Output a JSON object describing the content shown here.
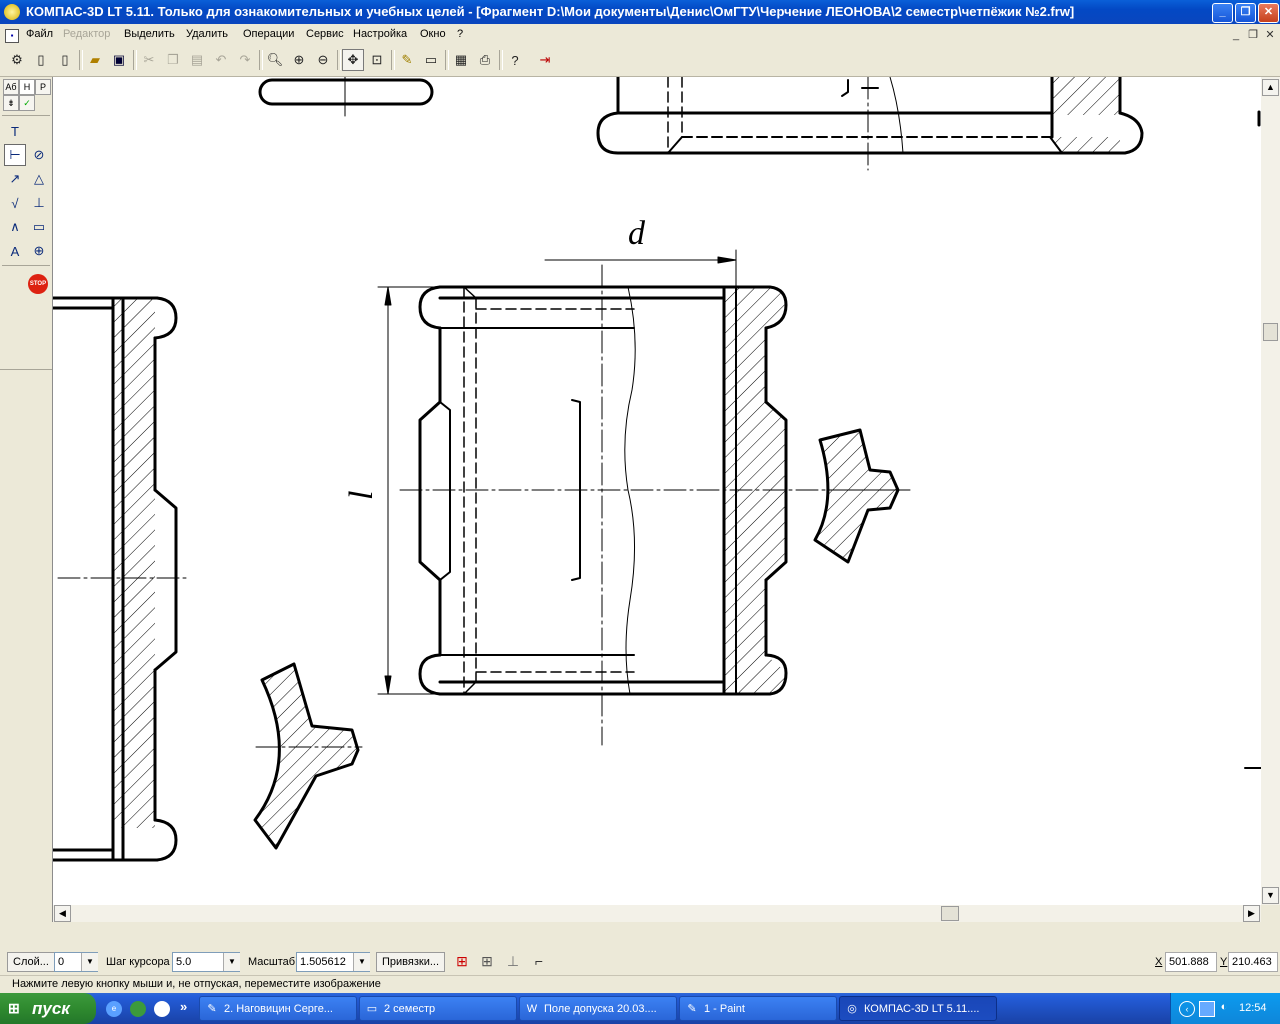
{
  "window": {
    "title": "КОМПАС-3D LT 5.11. Только для ознакомительных и учебных целей - [Фрагмент D:\\Мои документы\\Денис\\ОмГТУ\\Черчение ЛЕОНОВА\\2 семестр\\четпёжик №2.frw]",
    "min": "_",
    "max": "❐",
    "close": "✕"
  },
  "menu": {
    "items": [
      "Файл",
      "Редактор",
      "Выделить",
      "Удалить",
      "Операции",
      "Сервис",
      "Настройка",
      "Окно",
      "?"
    ],
    "doc_controls": [
      "_",
      "❐",
      "✕"
    ]
  },
  "toolbar": {
    "icons": [
      "gear-icon",
      "new-icon",
      "new-fragment-icon",
      "open-folder-icon",
      "save-icon",
      "cut-icon",
      "copy-icon",
      "paste-icon",
      "undo-icon",
      "redo-icon",
      "zoom-icon",
      "zoom-in-icon",
      "zoom-out-icon",
      "pan-icon",
      "zoom-fit-icon",
      "layers-icon",
      "refresh-icon",
      "print-preview-icon",
      "print-icon",
      "help-icon",
      "exit-icon"
    ]
  },
  "leftpanel": {
    "tabs": [
      "Аб",
      "Н",
      "Р"
    ],
    "stop": "STOP"
  },
  "drawing": {
    "dim_d": "d",
    "dim_l": "l"
  },
  "statusbar": {
    "layer_btn": "Слой...",
    "layer_value": "0",
    "step_label": "Шаг курсора",
    "step_value": "5.0",
    "scale_label": "Масштаб",
    "scale_value": "1.505612",
    "snaps_btn": "Привязки...",
    "x_label": "X",
    "x_value": "501.888",
    "y_label": "Y",
    "y_value": "210.463",
    "hint": "Нажмите левую кнопку мыши и, не отпуская, переместите изображение"
  },
  "taskbar": {
    "start": "пуск",
    "tasks": [
      {
        "label": "2. Наговицин Серге...",
        "icon": "✎"
      },
      {
        "label": "2 семестр",
        "icon": "▭"
      },
      {
        "label": "Поле допуска 20.03....",
        "icon": "W"
      },
      {
        "label": "1 - Paint",
        "icon": "✎"
      },
      {
        "label": "КОМПАС-3D LT 5.11....",
        "icon": "◎"
      }
    ],
    "clock": "12:54"
  }
}
